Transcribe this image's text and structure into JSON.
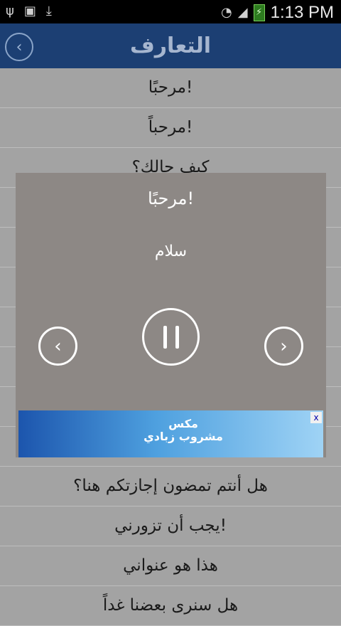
{
  "status": {
    "time": "1:13 PM"
  },
  "header": {
    "title": "التعارف"
  },
  "list": {
    "items": [
      "مرحبًا!",
      "مرحباً!",
      "كيف حالك؟",
      "هل أنتم تمضون إجازتكم هنا؟",
      "يجب أن تزورني!",
      "هذا هو عنواني",
      "هل سنرى بعضنا غداً"
    ]
  },
  "player": {
    "title": "مرحبًا!",
    "translation": "سلام"
  },
  "ad": {
    "brand_line1": "مكس",
    "brand_line2": "مشروب زبادي"
  }
}
